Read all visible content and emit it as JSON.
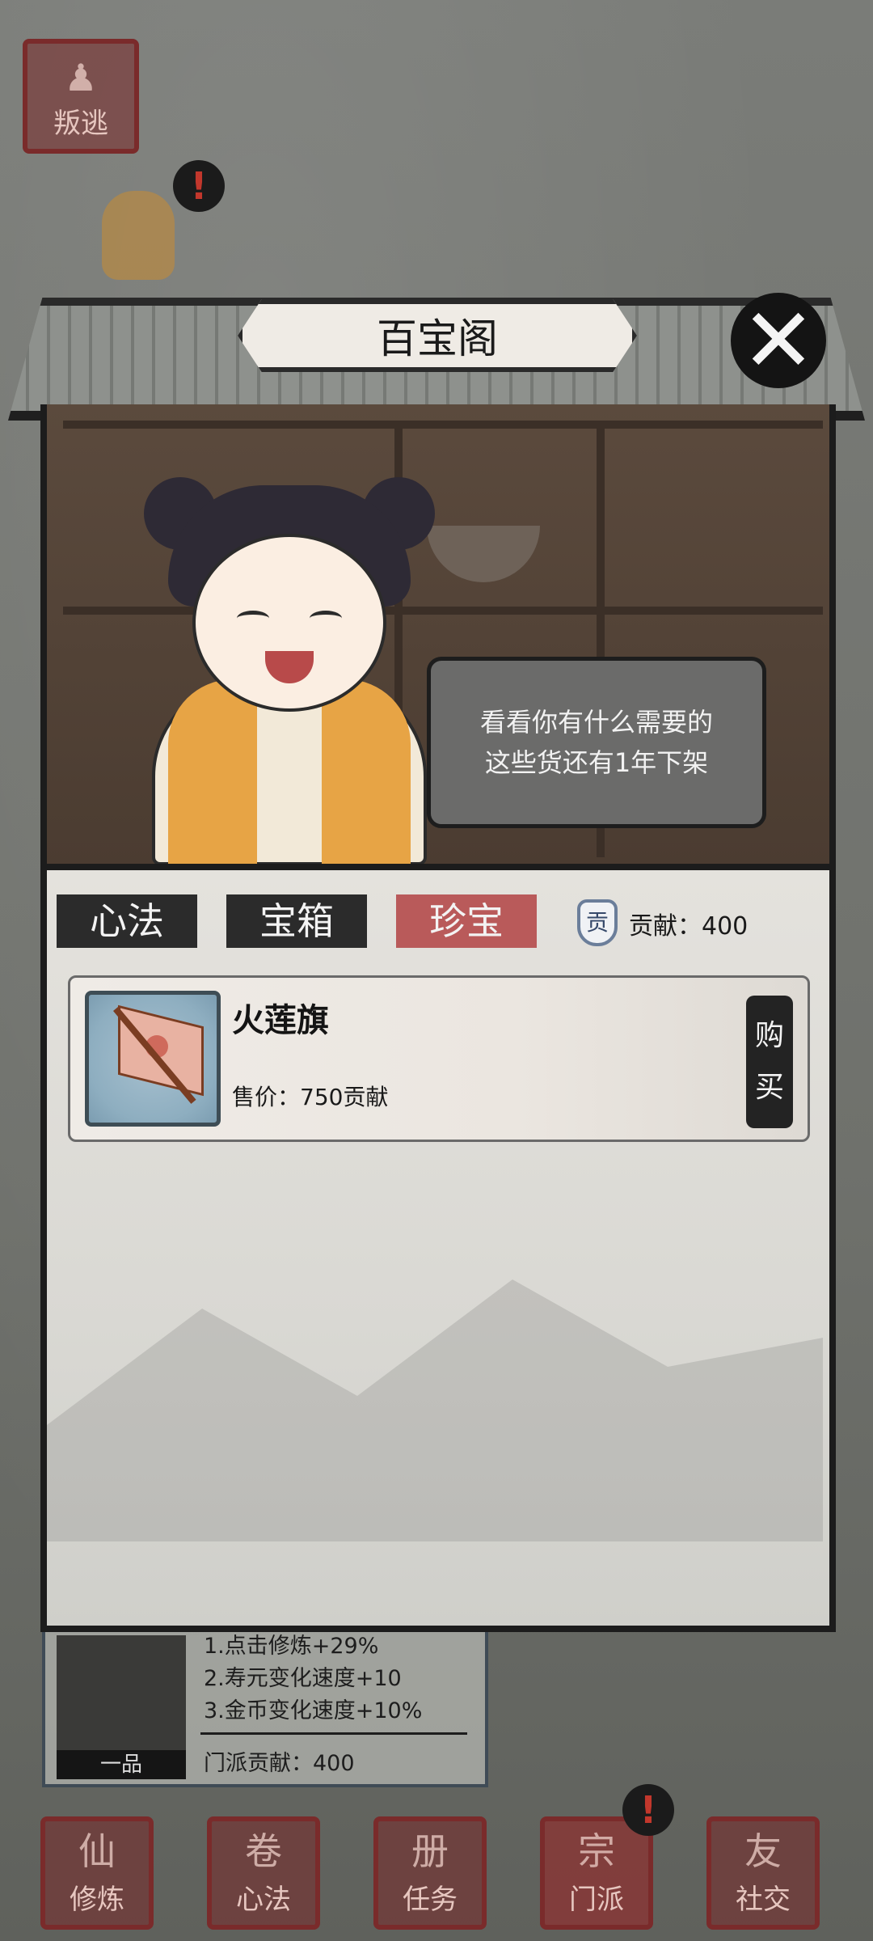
{
  "top_left": {
    "defect_label": "叛逃"
  },
  "dialog": {
    "title": "百宝阁"
  },
  "speech": {
    "line1": "看看你有什么需要的",
    "line2": "这些货还有1年下架"
  },
  "tabs": [
    {
      "label": "心法",
      "active": false
    },
    {
      "label": "宝箱",
      "active": false
    },
    {
      "label": "珍宝",
      "active": true
    }
  ],
  "contribution": {
    "icon_label": "贡",
    "text": "贡献：400"
  },
  "items": [
    {
      "name": "火莲旗",
      "price": "售价：750贡献",
      "buy_label_1": "购",
      "buy_label_2": "买",
      "icon": "fire-lotus-flag-icon"
    }
  ],
  "sect_panel": {
    "rank": "一品",
    "bonus1": "1.点击修炼+29%",
    "bonus2": "2.寿元变化速度+10",
    "bonus3": "3.金币变化速度+10%",
    "contribution": "门派贡献：400"
  },
  "bottom_nav": [
    {
      "label": "修炼",
      "glyph": "仙"
    },
    {
      "label": "心法",
      "glyph": "卷"
    },
    {
      "label": "任务",
      "glyph": "册"
    },
    {
      "label": "门派",
      "glyph": "宗"
    },
    {
      "label": "社交",
      "glyph": "友"
    }
  ],
  "colors": {
    "accent_red": "#b95a5a",
    "seal_red": "#7a2b2b",
    "ink": "#1c1c1c"
  }
}
